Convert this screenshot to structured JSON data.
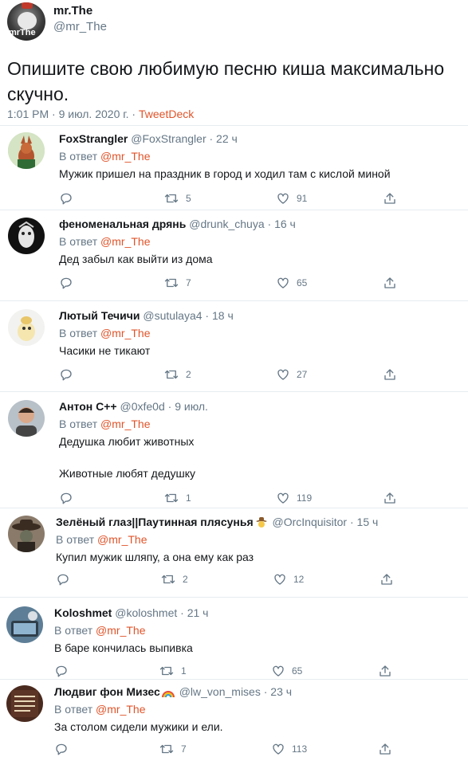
{
  "tweet": {
    "author_name": "mr.The",
    "author_handle": "@mr_The",
    "avatar_text": "mrThe",
    "text": "Опишите свою любимую песню киша максимально скучно.",
    "time": "1:01 PM · 9 июл. 2020 г. · ",
    "source": "TweetDeck"
  },
  "replies": [
    {
      "name": "FoxStrangler",
      "handle": "@FoxStrangler",
      "time": " · 22 ч",
      "reply_prefix": "В ответ ",
      "reply_to": "@mr_The",
      "text": "Мужик пришел на праздник в город и ходил там с кислой миной",
      "retweets": "5",
      "likes": "91"
    },
    {
      "name": "феноменальная дрянь",
      "handle": "@drunk_chuya",
      "time": " · 16 ч",
      "reply_prefix": "В ответ ",
      "reply_to": "@mr_The",
      "text": "Дед забыл как выйти из дома",
      "retweets": "7",
      "likes": "65"
    },
    {
      "name": "Лютый Течичи",
      "handle": "@sutulaya4",
      "time": " · 18 ч",
      "reply_prefix": "В ответ ",
      "reply_to": "@mr_The",
      "text": "Часики не тикают",
      "retweets": "2",
      "likes": "27"
    },
    {
      "name": "Антон С++",
      "handle": "@0xfe0d",
      "time": " · 9 июл.",
      "reply_prefix": "В ответ ",
      "reply_to": "@mr_The",
      "text": "Дедушка любит животных",
      "text2": "Животные любят дедушку",
      "retweets": "1",
      "likes": "119"
    },
    {
      "name": "Зелёный глаз||Паутинная плясунья",
      "handle": "@OrcInquisitor",
      "time": " · 15 ч",
      "reply_prefix": "В ответ ",
      "reply_to": "@mr_The",
      "text": "Купил мужик шляпу, а она ему как раз",
      "retweets": "2",
      "likes": "12"
    },
    {
      "name": "Koloshmet",
      "handle": "@koloshmet",
      "time": " · 21 ч",
      "reply_prefix": "В ответ ",
      "reply_to": "@mr_The",
      "text": "В баре кончилась выпивка",
      "retweets": "1",
      "likes": "65"
    },
    {
      "name": "Людвиг фон Мизес",
      "handle": "@lw_von_mises",
      "time": " · 23 ч",
      "reply_prefix": "В ответ ",
      "reply_to": "@mr_The",
      "text": "За столом сидели мужики и ели.",
      "retweets": "7",
      "likes": "113"
    }
  ],
  "colors": {
    "link": "#e0542a",
    "muted": "#657786",
    "text": "#14171a",
    "separator": "#e6ecf0"
  },
  "icons": {
    "reply": "reply-icon",
    "retweet": "retweet-icon",
    "like": "like-icon",
    "share": "share-icon"
  }
}
